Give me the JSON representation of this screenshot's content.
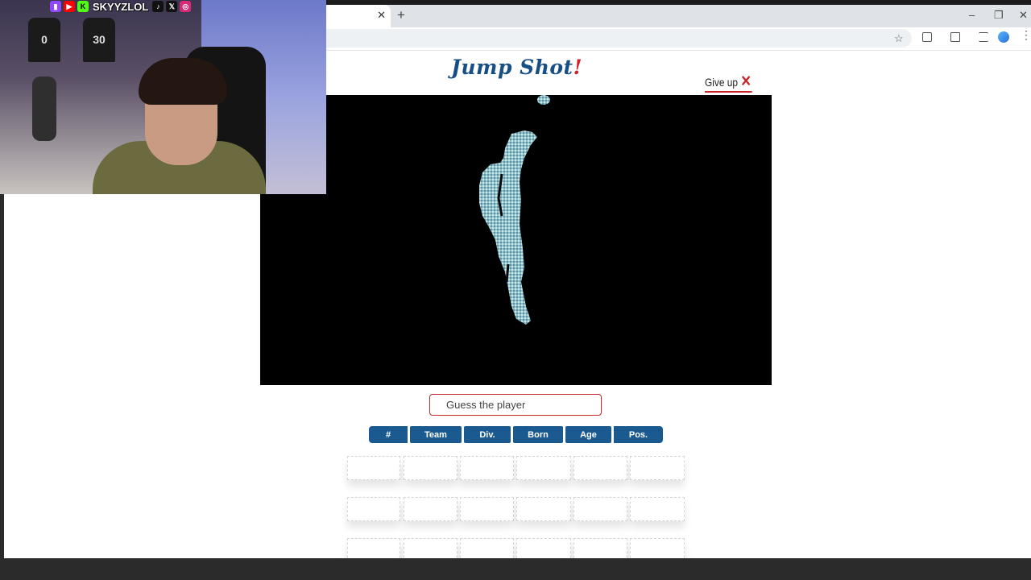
{
  "browser": {
    "tab_close": "✕",
    "new_tab": "+",
    "window_controls": [
      "–",
      "❐",
      "✕"
    ],
    "bookmark_icon": "star-icon"
  },
  "game": {
    "logo_text": "Jump Shot",
    "logo_accent": "!",
    "give_up_label": "Give up",
    "give_up_icon": "✕",
    "guess_placeholder": "Guess the player",
    "columns": [
      "#",
      "Team",
      "Div.",
      "Born",
      "Age",
      "Pos."
    ],
    "guess_rows_visible": 3
  },
  "overlay": {
    "streamer_handle": "SKYYZLOL",
    "social_icons": [
      "twitch-icon",
      "youtube-icon",
      "kick-icon",
      "tiktok-icon",
      "x-icon",
      "instagram-icon"
    ],
    "jersey_numbers": [
      "0",
      "30"
    ]
  },
  "colors": {
    "brand_blue": "#1b5a91",
    "accent_red": "#c8262d"
  }
}
